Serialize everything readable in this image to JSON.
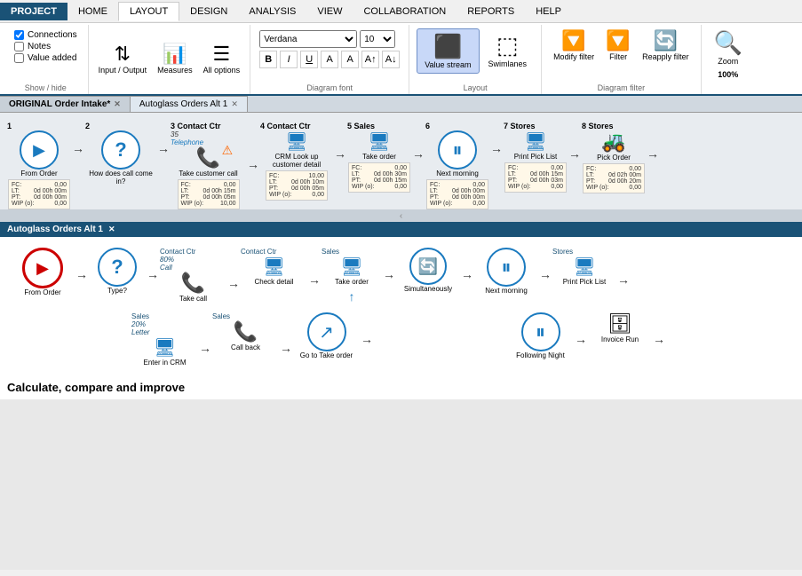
{
  "menubar": {
    "items": [
      {
        "label": "PROJECT",
        "active": false,
        "style": "project"
      },
      {
        "label": "HOME",
        "active": false
      },
      {
        "label": "LAYOUT",
        "active": true
      },
      {
        "label": "DESIGN",
        "active": false
      },
      {
        "label": "ANALYSIS",
        "active": false
      },
      {
        "label": "VIEW",
        "active": false
      },
      {
        "label": "COLLABORATION",
        "active": false
      },
      {
        "label": "REPORTS",
        "active": false
      },
      {
        "label": "HELP",
        "active": false
      }
    ]
  },
  "ribbon": {
    "showhide_label": "Show / hide",
    "checkboxes": [
      {
        "label": "Connections",
        "checked": true
      },
      {
        "label": "Notes",
        "checked": false
      },
      {
        "label": "Value added",
        "checked": false
      }
    ],
    "input_output_label": "Input /\nOutput",
    "measures_label": "Measures",
    "all_options_label": "All options",
    "font_family": "Verdana",
    "font_size": "10",
    "diagram_font_label": "Diagram font",
    "layout_label": "Layout",
    "layout_buttons": [
      {
        "label": "Value stream",
        "active": true
      },
      {
        "label": "Swimlanes",
        "active": false
      }
    ],
    "filter_buttons": [
      {
        "label": "Modify\nfilter"
      },
      {
        "label": "Filter"
      },
      {
        "label": "Reapply\nfilter"
      }
    ],
    "diagram_filter_label": "Diagram filter",
    "zoom_label": "Zoom",
    "zoom_value": "100%"
  },
  "tabs": [
    {
      "label": "ORIGINAL Order Intake*",
      "active": true,
      "closeable": true
    },
    {
      "label": "Autoglass Orders Alt 1",
      "active": false,
      "closeable": true
    }
  ],
  "top_diagram": {
    "nodes": [
      {
        "num": "1",
        "type": "play",
        "label": "From Order",
        "sub": ""
      },
      {
        "num": "2",
        "type": "question",
        "label": "How does call come in?",
        "sub": ""
      },
      {
        "num": "3",
        "type": "phone",
        "label": "Take customer call",
        "sub": "3 Contact Ctr",
        "note": "35\nTelephone",
        "warning": true
      },
      {
        "num": "4",
        "type": "monitor",
        "label": "CRM Look up customer detail",
        "sub": "4 Contact Ctr"
      },
      {
        "num": "5",
        "type": "monitor",
        "label": "Take order",
        "sub": "5 Sales"
      },
      {
        "num": "6",
        "type": "pause",
        "label": "Next morning",
        "sub": "6"
      },
      {
        "num": "7",
        "type": "monitor",
        "label": "Print Pick List",
        "sub": "7 Stores"
      },
      {
        "num": "8",
        "type": "forklift",
        "label": "Pick Order",
        "sub": "8 Stores"
      }
    ],
    "data_rows": [
      {
        "fc": "0,00",
        "lt": "0d 00h 00m",
        "pt": "0d 00h 00m",
        "wip": "0,00"
      },
      {
        "fc": "0,00",
        "lt": "0d 00h 15m",
        "pt": "0d 00h 05m",
        "wip": "10,00"
      },
      {
        "fc": "10,00",
        "lt": "0d 00h 10m",
        "pt": "0d 00h 05m",
        "wip": "0,00"
      },
      {
        "fc": "0,00",
        "lt": "0d 00h 30m",
        "pt": "0d 00h 15m",
        "wip": "0,00"
      },
      {
        "fc": "0,00",
        "lt": "0d 00h 00m",
        "pt": "0d 00h 00m",
        "wip": "0,00"
      },
      {
        "fc": "0,00",
        "lt": "0d 00h 15m",
        "pt": "0d 00h 03m",
        "wip": "0,00"
      },
      {
        "fc": "0,00",
        "lt": "0d 02h 00m",
        "pt": "0d 00h 20m",
        "wip": "0,00"
      }
    ]
  },
  "bottom_diagram": {
    "title": "Autoglass Orders Alt 1",
    "top_flow": [
      {
        "type": "play_red",
        "label": "From Order"
      },
      {
        "type": "question",
        "label": "Type?"
      },
      {
        "type": "phone",
        "label": "Take call",
        "dept": "Contact Ctr",
        "pct": "80%\nCall"
      },
      {
        "type": "monitor",
        "label": "Check detail",
        "dept": "Contact Ctr"
      },
      {
        "type": "monitor",
        "label": "Take order",
        "dept": "Sales"
      },
      {
        "type": "refresh",
        "label": "Simultaneously"
      },
      {
        "type": "pause",
        "label": "Next morning"
      },
      {
        "type": "monitor",
        "label": "Print Pick List",
        "dept": "Stores"
      }
    ],
    "bottom_flow": [
      {
        "type": "monitor",
        "label": "Enter in CRM",
        "dept": "Sales",
        "pct": "20%\nLetter"
      },
      {
        "type": "phone",
        "label": "Call back",
        "dept": "Sales"
      },
      {
        "type": "up_arrow_circle",
        "label": "Go to Take order"
      },
      {
        "type": "pause",
        "label": "Following Night"
      },
      {
        "type": "server",
        "label": "Invoice Run"
      }
    ]
  },
  "bottom_text": "Calculate, compare and improve"
}
